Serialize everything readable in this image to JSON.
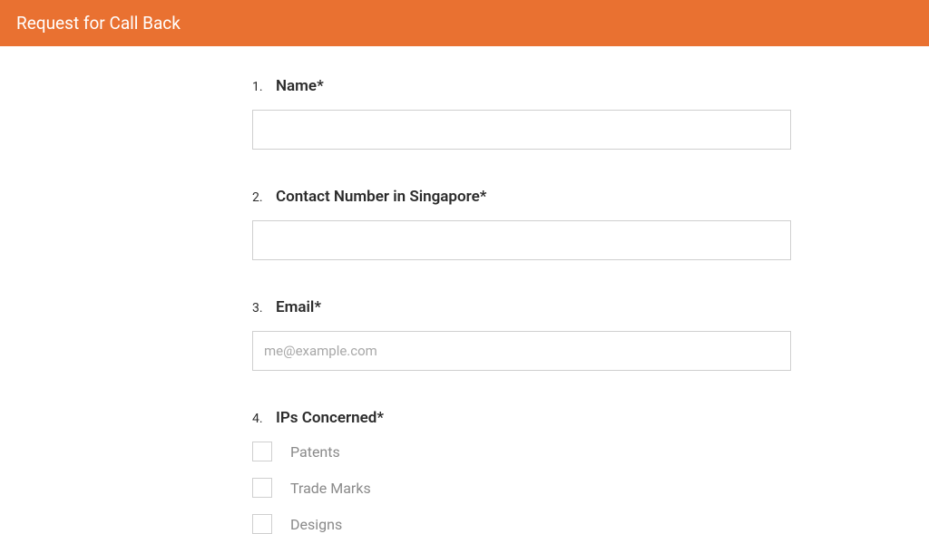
{
  "header": {
    "title": "Request for Call Back"
  },
  "form": {
    "fields": [
      {
        "number": "1.",
        "label": "Name*",
        "placeholder": "",
        "value": ""
      },
      {
        "number": "2.",
        "label": "Contact Number in Singapore*",
        "placeholder": "",
        "value": ""
      },
      {
        "number": "3.",
        "label": "Email*",
        "placeholder": "me@example.com",
        "value": ""
      },
      {
        "number": "4.",
        "label": "IPs Concerned*"
      }
    ],
    "ip_options": [
      "Patents",
      "Trade Marks",
      "Designs"
    ]
  }
}
